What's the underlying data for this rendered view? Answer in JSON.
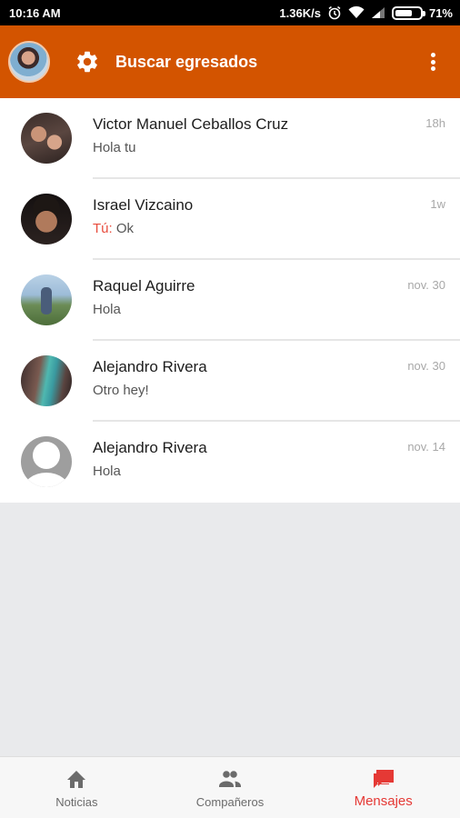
{
  "status_bar": {
    "time": "10:16 AM",
    "speed": "1.36K/s",
    "battery": "71%",
    "battery_level": 0.71,
    "icons": [
      "alarm-icon",
      "wifi-icon",
      "signal-icon",
      "battery-icon"
    ]
  },
  "app_bar": {
    "title": "Buscar egresados",
    "color": "#d35400",
    "icons": [
      "settings-icon",
      "overflow-menu-icon"
    ]
  },
  "conversations": [
    {
      "name": "Victor Manuel Ceballos Cruz",
      "preview": "Hola tu",
      "you_prefix": "",
      "time": "18h"
    },
    {
      "name": "Israel Vizcaino",
      "preview": "Ok",
      "you_prefix": "Tú: ",
      "time": "1w"
    },
    {
      "name": "Raquel Aguirre",
      "preview": "Hola",
      "you_prefix": "",
      "time": "nov. 30"
    },
    {
      "name": "Alejandro Rivera",
      "preview": "Otro hey!",
      "you_prefix": "",
      "time": "nov. 30"
    },
    {
      "name": "Alejandro Rivera",
      "preview": "Hola",
      "you_prefix": "",
      "time": "nov. 14"
    }
  ],
  "bottom_nav": {
    "items": [
      {
        "label": "Noticias",
        "icon": "home-icon"
      },
      {
        "label": "Compañeros",
        "icon": "people-icon"
      },
      {
        "label": "Mensajes",
        "icon": "messages-icon"
      }
    ],
    "active_index": 2,
    "active_color": "#e53935"
  }
}
